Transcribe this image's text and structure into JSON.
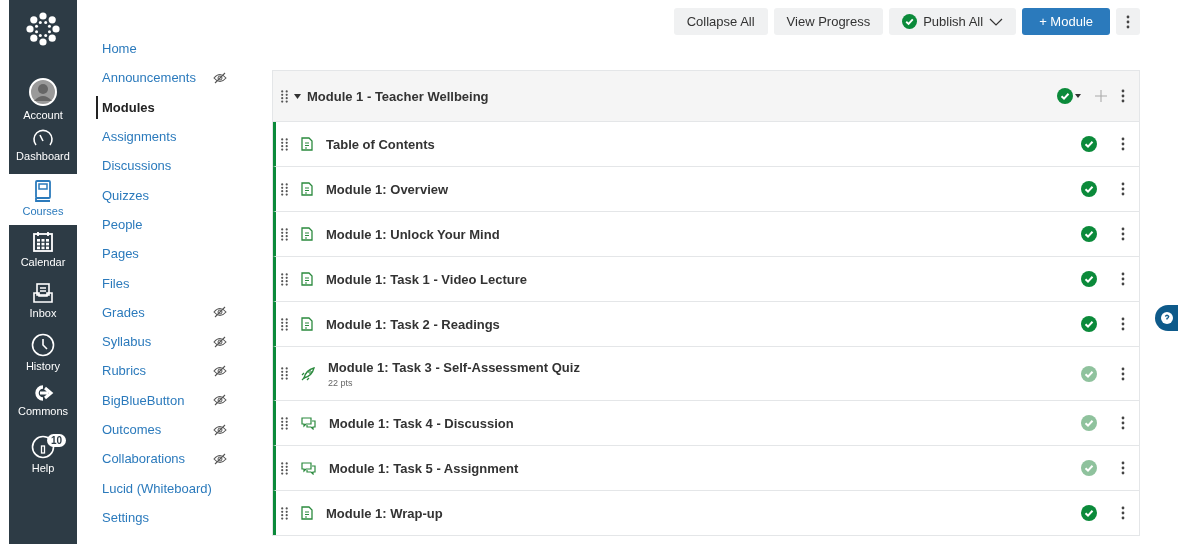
{
  "global_nav": [
    {
      "kind": "logo",
      "selected": false
    },
    {
      "kind": "account",
      "label": "Account",
      "selected": false
    },
    {
      "kind": "dashboard",
      "label": "Dashboard",
      "selected": false
    },
    {
      "kind": "courses",
      "label": "Courses",
      "selected": true
    },
    {
      "kind": "calendar",
      "label": "Calendar",
      "selected": false
    },
    {
      "kind": "inbox",
      "label": "Inbox",
      "selected": false
    },
    {
      "kind": "history",
      "label": "History",
      "selected": false
    },
    {
      "kind": "commons",
      "label": "Commons",
      "selected": false
    },
    {
      "kind": "help",
      "label": "Help",
      "selected": false,
      "badge": "10"
    }
  ],
  "course_nav": [
    {
      "label": "Home",
      "selected": false,
      "hidden": false
    },
    {
      "label": "Announcements",
      "selected": false,
      "hidden": true
    },
    {
      "label": "Modules",
      "selected": true,
      "hidden": false
    },
    {
      "label": "Assignments",
      "selected": false,
      "hidden": false
    },
    {
      "label": "Discussions",
      "selected": false,
      "hidden": false
    },
    {
      "label": "Quizzes",
      "selected": false,
      "hidden": false
    },
    {
      "label": "People",
      "selected": false,
      "hidden": false
    },
    {
      "label": "Pages",
      "selected": false,
      "hidden": false
    },
    {
      "label": "Files",
      "selected": false,
      "hidden": false
    },
    {
      "label": "Grades",
      "selected": false,
      "hidden": true
    },
    {
      "label": "Syllabus",
      "selected": false,
      "hidden": true
    },
    {
      "label": "Rubrics",
      "selected": false,
      "hidden": true
    },
    {
      "label": "BigBlueButton",
      "selected": false,
      "hidden": true
    },
    {
      "label": "Outcomes",
      "selected": false,
      "hidden": true
    },
    {
      "label": "Collaborations",
      "selected": false,
      "hidden": true
    },
    {
      "label": "Lucid (Whiteboard)",
      "selected": false,
      "hidden": false
    },
    {
      "label": "Settings",
      "selected": false,
      "hidden": false
    }
  ],
  "toolbar": {
    "collapse_all": "Collapse All",
    "view_progress": "View Progress",
    "publish_all": "Publish All",
    "add_module": "+ Module"
  },
  "module": {
    "title": "Module 1 - Teacher Wellbeing",
    "items": [
      {
        "kind": "page",
        "title": "Table of Contents",
        "dimmed": false
      },
      {
        "kind": "page",
        "title": "Module 1: Overview",
        "dimmed": false
      },
      {
        "kind": "page",
        "title": "Module 1: Unlock Your Mind",
        "dimmed": false
      },
      {
        "kind": "page",
        "title": "Module 1: Task 1 - Video Lecture",
        "dimmed": false
      },
      {
        "kind": "page",
        "title": "Module 1: Task 2 - Readings",
        "dimmed": false
      },
      {
        "kind": "quiz",
        "title": "Module 1: Task 3 - Self-Assessment Quiz",
        "points": "22 pts",
        "dimmed": true
      },
      {
        "kind": "discussion",
        "title": "Module 1: Task 4 - Discussion",
        "dimmed": true
      },
      {
        "kind": "discussion",
        "title": "Module 1: Task 5 - Assignment",
        "dimmed": true
      },
      {
        "kind": "page",
        "title": "Module 1: Wrap-up",
        "dimmed": false
      }
    ]
  }
}
